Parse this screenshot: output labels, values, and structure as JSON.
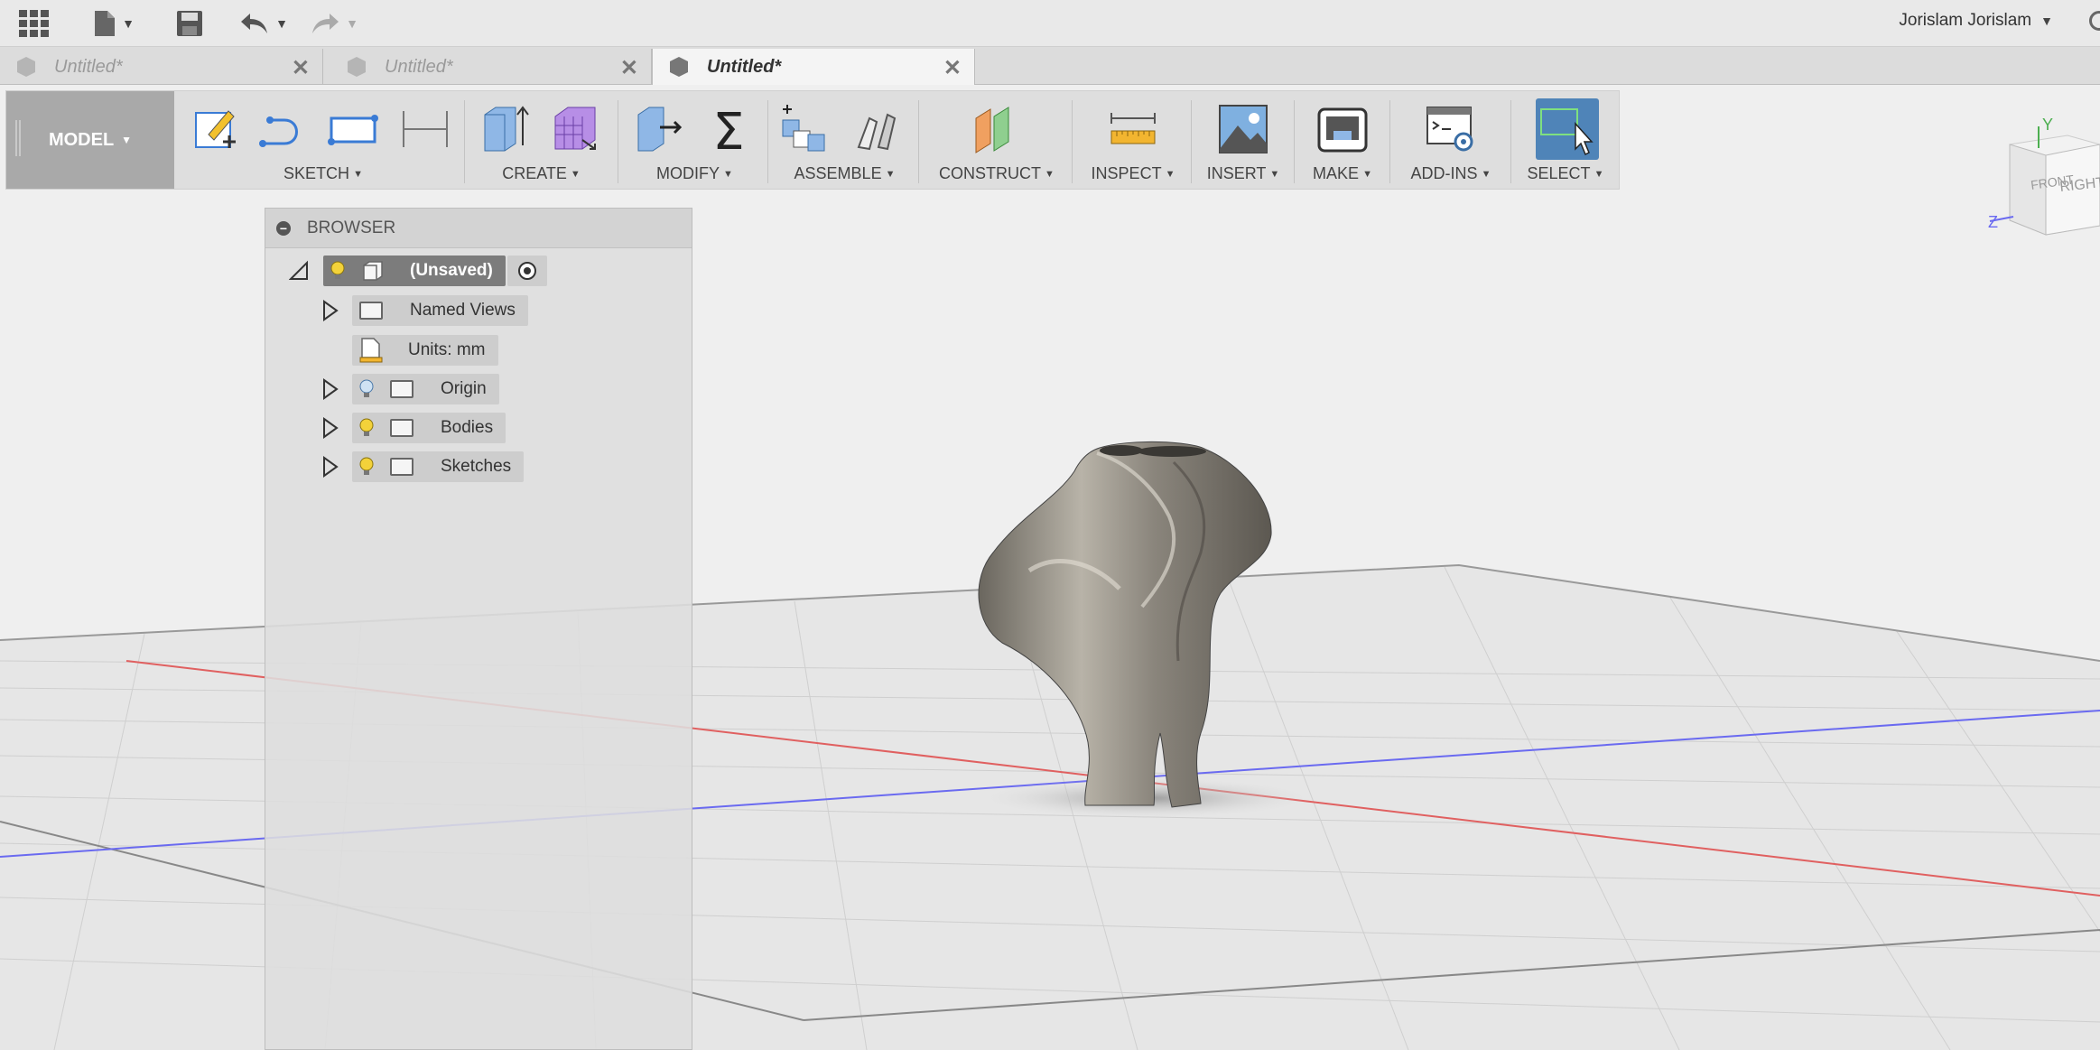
{
  "toolbar": {
    "user_name": "Jorislam Jorislam",
    "icons": [
      "apps-grid-icon",
      "file-icon",
      "save-icon",
      "undo-icon",
      "redo-icon"
    ]
  },
  "tabs": [
    {
      "label": "Untitled*",
      "active": false
    },
    {
      "label": "Untitled*",
      "active": false
    },
    {
      "label": "Untitled*",
      "active": true
    }
  ],
  "ribbon": {
    "workspace": "MODEL",
    "groups": {
      "sketch": "SKETCH",
      "create": "CREATE",
      "modify": "MODIFY",
      "assemble": "ASSEMBLE",
      "construct": "CONSTRUCT",
      "inspect": "INSPECT",
      "insert": "INSERT",
      "make": "MAKE",
      "addins": "ADD-INS",
      "select": "SELECT"
    }
  },
  "browser": {
    "title": "BROWSER",
    "root": "(Unsaved)",
    "items": [
      {
        "label": "Named Views",
        "has_bulb": false
      },
      {
        "label": "Units: mm",
        "has_bulb": false
      },
      {
        "label": "Origin",
        "has_bulb": true
      },
      {
        "label": "Bodies",
        "has_bulb": true
      },
      {
        "label": "Sketches",
        "has_bulb": true
      }
    ]
  },
  "viewcube": {
    "faces": [
      "FRONT",
      "RIGHT"
    ],
    "axes": [
      "Y",
      "Z"
    ]
  },
  "colors": {
    "accent": "#4f84b8",
    "x_axis": "#e06060",
    "z_axis": "#6a6af0",
    "body": "#8a857c"
  }
}
